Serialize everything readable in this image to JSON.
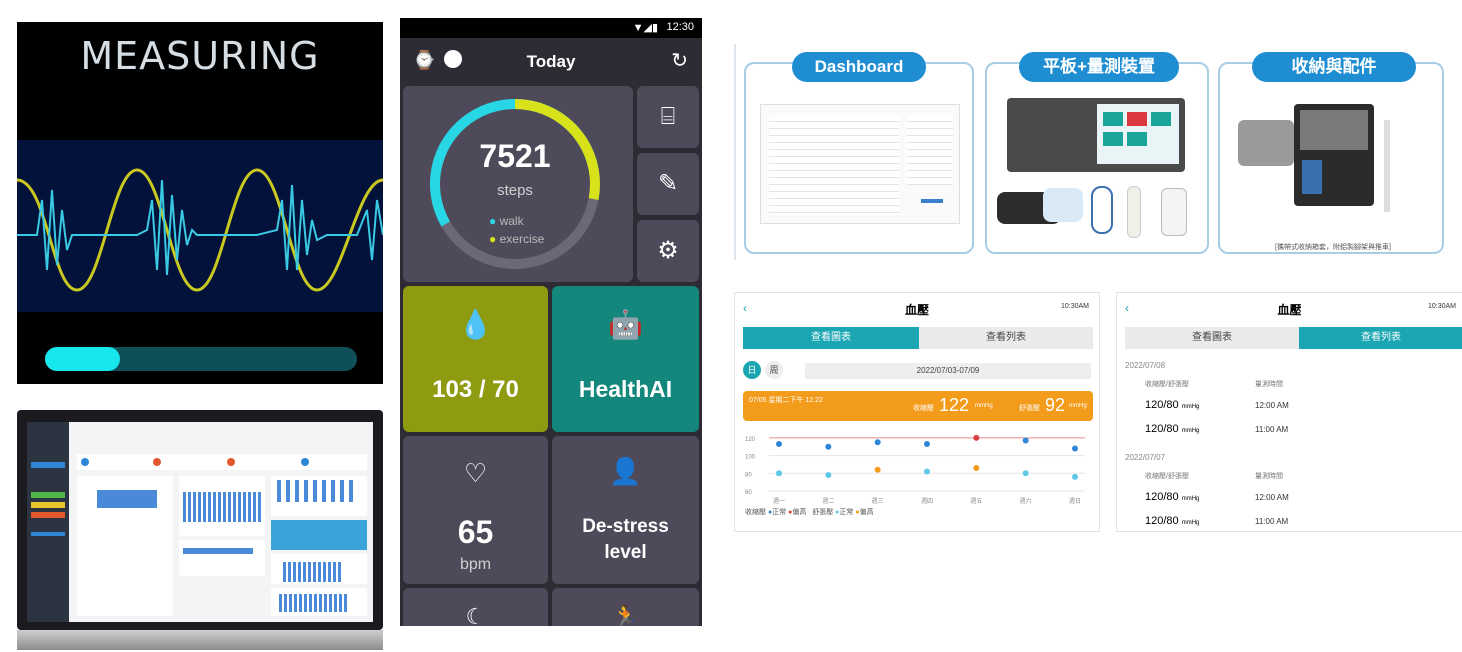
{
  "measuring": {
    "title": "MEASURING",
    "progress": 0.24,
    "colors": {
      "wave_primary": "#39c9e3",
      "wave_secondary": "#c8c820",
      "band": "#03123a",
      "progress": "#18e6ef"
    }
  },
  "phone": {
    "status_time": "12:30",
    "appbar_title": "Today",
    "steps_value": "7521",
    "steps_unit": "steps",
    "legend_walk": "walk",
    "legend_exercise": "exercise",
    "steps_progress": 0.88,
    "blood_pressure": "103 / 70",
    "healthai_label": "HealthAI",
    "heart_rate": "65",
    "heart_rate_unit": "bpm",
    "destress_line1": "De-stress",
    "destress_line2": "level",
    "colors": {
      "olive": "#8e9a10",
      "teal": "#14877c",
      "ring_walk": "#28d7e6",
      "ring_exercise": "#d8e21a"
    }
  },
  "cards": [
    {
      "title": "Dashboard"
    },
    {
      "title": "平板+量測裝置"
    },
    {
      "title": "收納與配件",
      "caption": "[攜帶式收納箱套，附鋁製腳架與推車]"
    }
  ],
  "chart_screen": {
    "title": "血壓",
    "time": "10:30AM",
    "tab_chart": "查看圖表",
    "tab_list": "查看列表",
    "day_button": "日",
    "week_button": "周",
    "date_range": "2022/07/03-07/09",
    "banner_time": "07/05 星期二下午 12:22",
    "banner_sys_label": "收縮壓",
    "banner_sys": "122",
    "banner_dia_label": "舒張壓",
    "banner_dia": "92",
    "banner_unit": "mmHg",
    "legend_sys": "收縮壓",
    "legend_dia": "舒張壓",
    "legend_normal": "正常",
    "legend_high": "偏高",
    "y_ticks": [
      "120",
      "100",
      "80",
      "60"
    ],
    "x_ticks": [
      "週一",
      "週二",
      "週三",
      "週四",
      "週五",
      "週六",
      "週日"
    ],
    "chart_data": {
      "type": "scatter",
      "series": [
        {
          "name": "收縮壓",
          "values": [
            113,
            110,
            115,
            113,
            120,
            117,
            108
          ]
        },
        {
          "name": "舒張壓",
          "values": [
            80,
            78,
            84,
            82,
            86,
            80,
            76
          ]
        }
      ],
      "categories": [
        "週一",
        "週二",
        "週三",
        "週四",
        "週五",
        "週六",
        "週日"
      ],
      "ylim": [
        60,
        130
      ]
    }
  },
  "list_screen": {
    "title": "血壓",
    "time": "10:30AM",
    "tab_chart": "查看圖表",
    "tab_list": "查看列表",
    "groups": [
      {
        "date": "2022/07/08",
        "col1": "收縮壓/舒張壓",
        "col2": "量測時間",
        "rows": [
          {
            "bp": "120/80",
            "unit": "mmHg",
            "time": "12:00 AM"
          },
          {
            "bp": "120/80",
            "unit": "mmHg",
            "time": "11:00 AM"
          }
        ]
      },
      {
        "date": "2022/07/07",
        "col1": "收縮壓/舒張壓",
        "col2": "量測時間",
        "rows": [
          {
            "bp": "120/80",
            "unit": "mmHg",
            "time": "12:00 AM"
          },
          {
            "bp": "120/80",
            "unit": "mmHg",
            "time": "11:00 AM"
          }
        ]
      }
    ]
  }
}
